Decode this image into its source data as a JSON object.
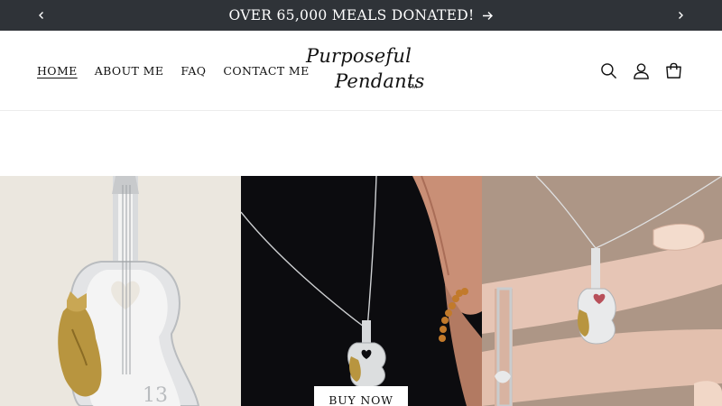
{
  "announcement": {
    "text": "OVER 65,000 MEALS DONATED!",
    "background": "#2f3338"
  },
  "nav": {
    "home": "HOME",
    "about": "ABOUT ME",
    "faq": "FAQ",
    "contact": "CONTACT ME"
  },
  "logo": {
    "line1": "Purposeful",
    "line2": "Pendants",
    "tm": "TM"
  },
  "header_icons": [
    "search-icon",
    "account-icon",
    "cart-icon"
  ],
  "hero": {
    "images": [
      "guitar-cat-pendant-closeup",
      "pendant-on-model-dark-background",
      "pendant-in-hand"
    ],
    "cta": "BUY NOW"
  }
}
